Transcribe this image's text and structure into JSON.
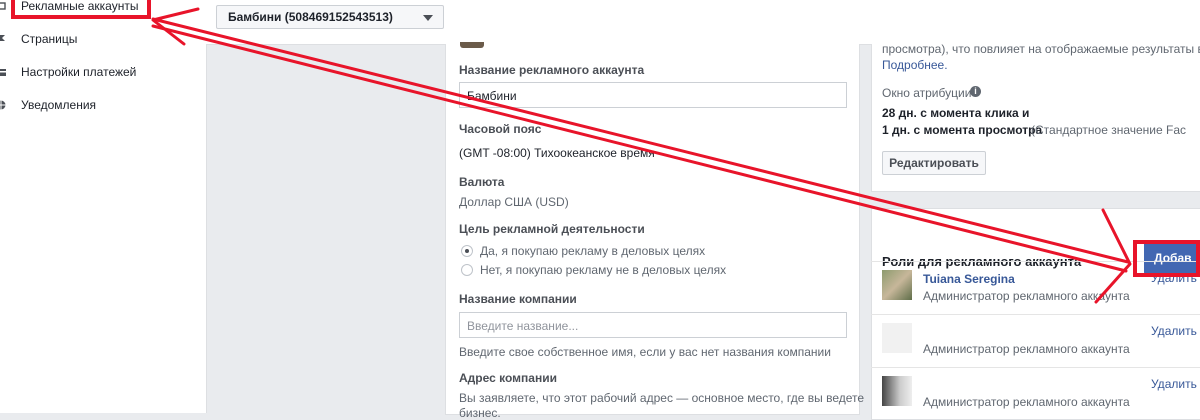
{
  "sidebar": {
    "items": [
      {
        "label": "Рекламные аккаунты",
        "icon": "ad-accounts-icon"
      },
      {
        "label": "Страницы",
        "icon": "flag-icon"
      },
      {
        "label": "Настройки платежей",
        "icon": "payment-icon"
      },
      {
        "label": "Уведомления",
        "icon": "globe-icon"
      }
    ]
  },
  "header": {
    "account_selector": "Бамбини (508469152543513)"
  },
  "form": {
    "account_name_label": "Название рекламного аккаунта",
    "account_name_value": "Бамбини",
    "timezone_label": "Часовой пояс",
    "timezone_value": "(GMT -08:00) Тихоокеанское время",
    "currency_label": "Валюта",
    "currency_value": "Доллар США (USD)",
    "purpose_label": "Цель рекламной деятельности",
    "purpose_options": [
      "Да, я покупаю рекламу в деловых целях",
      "Нет, я покупаю рекламу не в деловых целях"
    ],
    "company_label": "Название компании",
    "company_placeholder": "Введите название...",
    "company_hint": "Введите свое собственное имя, если у вас нет названия компании",
    "address_label": "Адрес компании",
    "address_hint_1": "Вы заявляете, что этот рабочий адрес — основное место, где вы ведете",
    "address_hint_2": "бизнес."
  },
  "attribution": {
    "text_top": "просмотра), что повлияет на отображаемые результаты ваш",
    "more_link": "Подробнее.",
    "window_label": "Окно атрибуции",
    "line1": "28 дн. с момента клика и",
    "line2_bold": "1 дн. с момента просмотра",
    "line2_muted": "(Стандартное значение Fac",
    "edit_button": "Редактировать"
  },
  "roles": {
    "title": "Роли для рекламного аккаунта",
    "add_button": "Добав",
    "remove_label": "Удалить п",
    "members": [
      {
        "name": "Tuiana Seregina",
        "role": "Администратор рекламного аккаунта"
      },
      {
        "name": "",
        "role": "Администратор рекламного аккаунта"
      },
      {
        "name": "",
        "role": "Администратор рекламного аккаунта"
      }
    ]
  },
  "colors": {
    "accent": "#4267b2",
    "annotation": "#e8142a",
    "link": "#385898"
  }
}
